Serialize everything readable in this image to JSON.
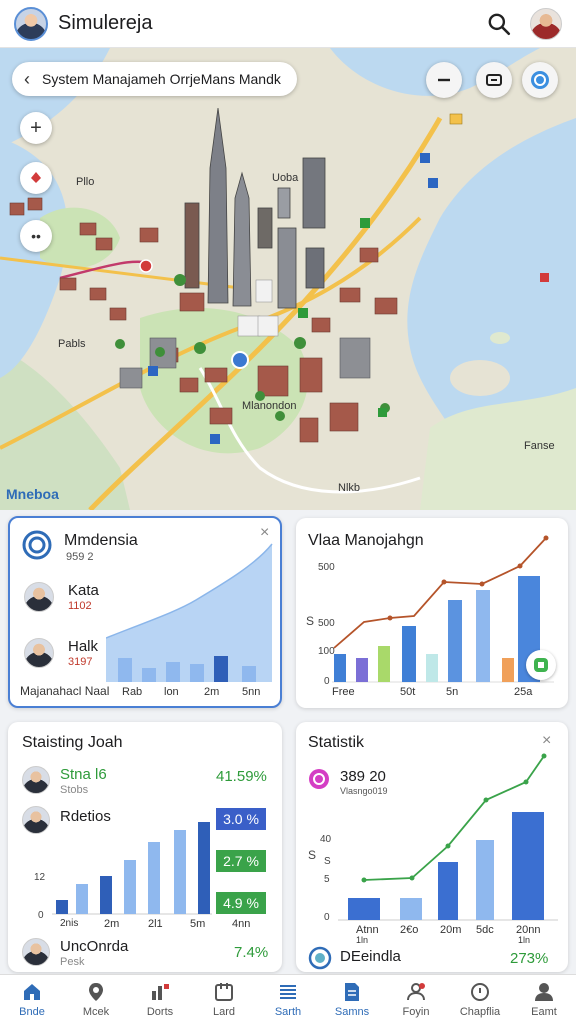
{
  "app": {
    "title": "Simulereja"
  },
  "map": {
    "breadcrumb": "System Manajameh OrrjeMans Mandk",
    "labels": [
      "Uoba",
      "Pabls",
      "Mlanondon",
      "Pllo",
      "Nlkb",
      "Fanse"
    ],
    "corner_label": "Mneboa"
  },
  "card1": {
    "title": "Mmdensia",
    "subtitle": "959 2",
    "people": [
      {
        "name": "Kata",
        "value": "1102"
      },
      {
        "name": "Halk",
        "value": "3197"
      }
    ],
    "footer": "Majanahacl Naal",
    "x_labels": [
      "Rab",
      "lon",
      "2m",
      "5nn"
    ]
  },
  "card2": {
    "title": "Vlaa Manojahgn",
    "y_labels": [
      "500",
      "S",
      "500",
      "100",
      "0"
    ],
    "x_labels": [
      "Free",
      "50t",
      "5n",
      "25a"
    ]
  },
  "card3": {
    "title": "Staisting Joah",
    "rows": [
      {
        "name": "Stna l6",
        "sub": "Stobs",
        "pct": "41.59%"
      },
      {
        "name": "Rdetios",
        "sub": "",
        "pct": ""
      }
    ],
    "badges": [
      "3.0 %",
      "2.7 %",
      "4.9 %"
    ],
    "y_labels": [
      "12",
      "0"
    ],
    "x_labels": [
      "2nis",
      "2m",
      "2l1",
      "5m",
      "4nn"
    ],
    "footer_row": {
      "name": "UncOnrda",
      "sub": "Pesk",
      "pct": "7.4%"
    }
  },
  "card4": {
    "title": "Statistik",
    "metric": {
      "value": "389 20",
      "sub": "Vlasngo019"
    },
    "y_labels": [
      "S",
      "40",
      "S",
      "5",
      "0"
    ],
    "x_labels": [
      "Atnn",
      "2€o",
      "20m",
      "5dc",
      "20nn"
    ],
    "x_sublabels": [
      "1ln",
      "",
      "",
      "",
      "1ln"
    ],
    "footer_row": {
      "name": "DEeindla",
      "sub": "",
      "pct": "273%"
    }
  },
  "nav": [
    {
      "label": "Bnde",
      "icon": "home-icon",
      "active": true
    },
    {
      "label": "Mcek",
      "icon": "location-pin-icon",
      "active": false
    },
    {
      "label": "Dorts",
      "icon": "chart-icon",
      "active": false
    },
    {
      "label": "Lard",
      "icon": "layout-icon",
      "active": false
    },
    {
      "label": "Sarth",
      "icon": "list-icon",
      "active": true
    },
    {
      "label": "Samns",
      "icon": "document-icon",
      "active": true
    },
    {
      "label": "Foyin",
      "icon": "people-icon",
      "active": false
    },
    {
      "label": "Chapflia",
      "icon": "compass-icon",
      "active": false
    },
    {
      "label": "Eamt",
      "icon": "person-icon",
      "active": false
    }
  ],
  "colors": {
    "accent": "#2f6cb7",
    "green": "#2e9b3a",
    "line_orange": "#b5542a"
  }
}
